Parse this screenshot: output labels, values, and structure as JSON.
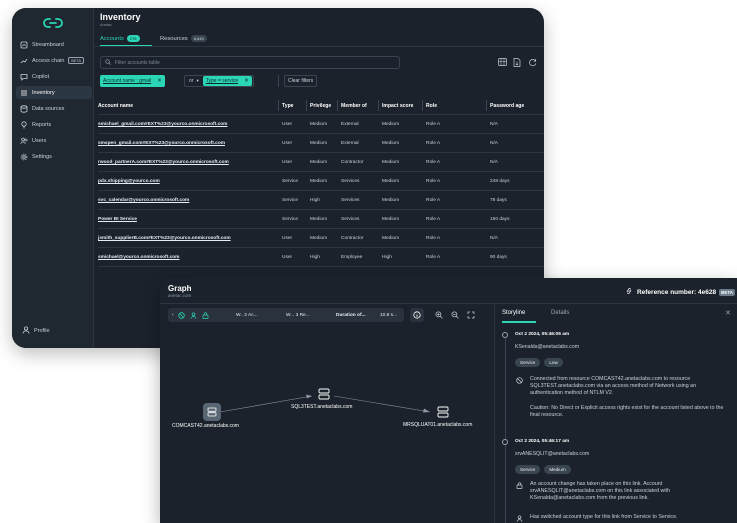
{
  "sidebar": {
    "items": [
      {
        "label": "Streamboard",
        "icon": "dashboard-icon"
      },
      {
        "label": "Access chain",
        "icon": "chain-icon",
        "badge": "BETA"
      },
      {
        "label": "Copilot",
        "icon": "chat-icon"
      },
      {
        "label": "Inventory",
        "icon": "list-icon"
      },
      {
        "label": "Data sources",
        "icon": "database-icon"
      },
      {
        "label": "Reports",
        "icon": "pin-icon"
      },
      {
        "label": "Users",
        "icon": "users-icon"
      },
      {
        "label": "Settings",
        "icon": "gear-icon"
      }
    ],
    "profile": "Profile"
  },
  "inventory": {
    "title": "Inventory",
    "subtitle": "Anetac",
    "tabs": [
      {
        "label": "Accounts",
        "count": "276"
      },
      {
        "label": "Resources",
        "count": "8,845"
      }
    ],
    "search_placeholder": "Filter accounts table",
    "filters": {
      "chip1": "Account name : gmail",
      "operator": "or",
      "chip2": "Type = service",
      "clear": "Clear filters"
    },
    "columns": [
      "Account name",
      "Type",
      "Privilege",
      "Member of",
      "Impact score",
      "Role",
      "Password age"
    ],
    "rows": [
      [
        "smichael_gmail.com#EXT%23@yourco.onmicrosoft.com",
        "User",
        "Medium",
        "External",
        "Medium",
        "Role A",
        "N/A"
      ],
      [
        "smspen_gmail.com#EXT%23@yourco.onmicrosoft.com",
        "User",
        "Medium",
        "External",
        "Medium",
        "Role A",
        "N/A"
      ],
      [
        "rwood_partnerA.com#EXT%23@yourco.onmicrosoft.com",
        "User",
        "Medium",
        "Contractor",
        "Medium",
        "Role A",
        "N/A"
      ],
      [
        "pdx.shipping@yourco.com",
        "Service",
        "Medium",
        "Services",
        "Medium",
        "Role A",
        "248 days"
      ],
      [
        "svc_calendar@yourco.onmicrosoft.com",
        "Service",
        "High",
        "Services",
        "Medium",
        "Role A",
        "78 days"
      ],
      [
        "Power BI Service",
        "Service",
        "Medium",
        "Services",
        "Medium",
        "Role A",
        "150 days"
      ],
      [
        "jsmith_supplierB.com#EXT%23@yourco.onmicrosoft.com",
        "User",
        "Medium",
        "Contractor",
        "Medium",
        "Role A",
        "N/A"
      ],
      [
        "smichael@yourco.onmicrosoft.com",
        "User",
        "High",
        "Employee",
        "High",
        "Role A",
        "90 days"
      ]
    ]
  },
  "graph": {
    "title": "Graph",
    "subtitle": "anetac.com",
    "reference_label": "Reference number: 4e628",
    "reference_badge": "BETA",
    "pathbar": {
      "w1": "W.. 2 Ac...",
      "w2": "W... 3 Re...",
      "duration": "Duration of...",
      "duration_value": "10.8 s..."
    },
    "nodes": {
      "source": "COMCAST42.anetaclabs.com",
      "middle": "SQL3TEST.anetaclabs.com",
      "target": "MRSQLUAT01.anetaclabs.com"
    },
    "tabs": [
      "Storyline",
      "Details"
    ],
    "events": [
      {
        "date": "Oct 2 2024, 05:46:06 am",
        "user": "KSenalda@anetaclabs.com",
        "pills": [
          "Service",
          "Low"
        ],
        "text": "Connected from resource COMCAST42.anetaclabs.com to resource SQL3TEST.anetaclabs.com via an access method of Network using an authentication method of NTLM V2.",
        "caution": "Caution: No Direct or Explicit access rights exist for the account listed above to the final resource."
      },
      {
        "date": "Oct 2 2024, 05:46:17 am",
        "user": "srvANESQLIT@anetaclabs.com",
        "pills": [
          "Service",
          "Medium"
        ],
        "text": "An account change has taken place on this link. Account srvANESQLIT@anetaclabs.com on this link associated with KSenalda@anetaclabs.com from the previous link.",
        "text2": "Has switched account type for this link from Service to Service."
      }
    ]
  },
  "colors": {
    "accent": "#2bd6b6",
    "background": "#1b222b",
    "sidebar": "#1f2730"
  }
}
